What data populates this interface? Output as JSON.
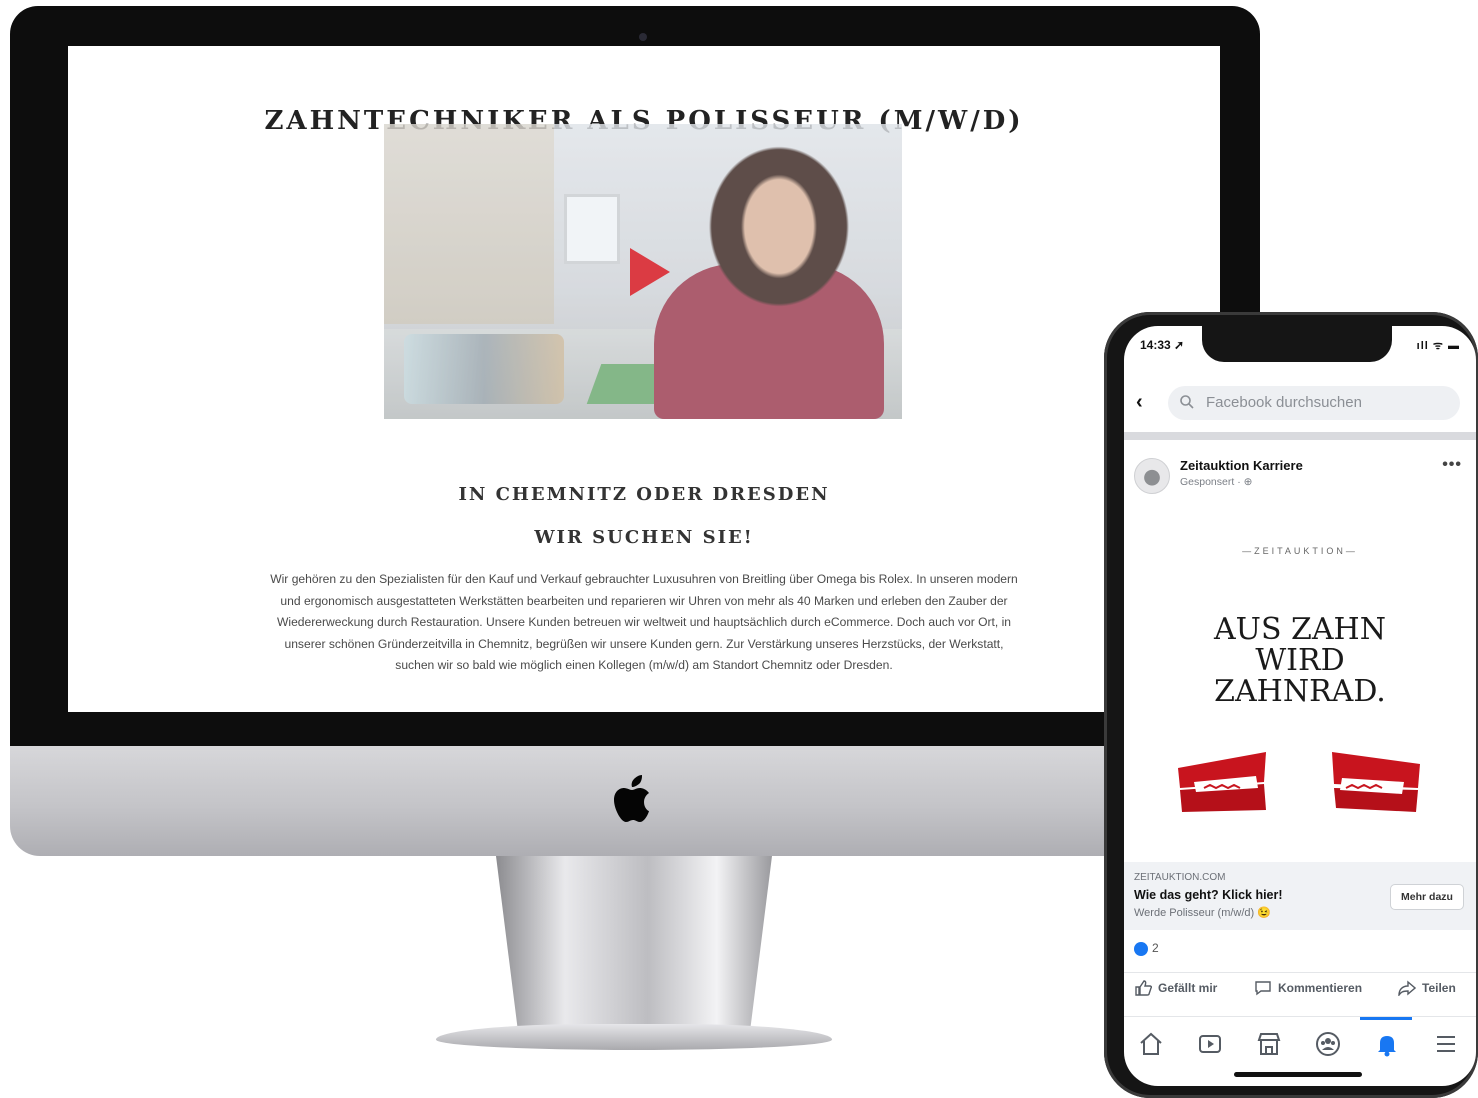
{
  "website": {
    "title": "ZAHNTECHNIKER ALS POLISSEUR (M/W/D)",
    "subheading_1": "IN CHEMNITZ ODER DRESDEN",
    "subheading_2": "WIR SUCHEN SIE!",
    "body": "Wir gehören zu den Spezialisten für den Kauf und Verkauf gebrauchter Luxusuhren von Breitling über Omega bis Rolex. In unseren modern und ergonomisch ausgestatteten Werkstätten bearbeiten und reparieren wir Uhren von mehr als 40 Marken und erleben den Zauber der Wiedererweckung durch Restauration. Unsere Kunden betreuen wir weltweit und hauptsächlich durch eCommerce. Doch auch vor Ort, in unserer schönen Gründerzeitvilla in Chemnitz, begrüßen wir unsere Kunden gern. Zur Verstärkung unseres Herzstücks, der Werkstatt, suchen wir so bald wie möglich einen Kollegen (m/w/d) am Standort Chemnitz oder Dresden.",
    "video_play_icon": "play-icon",
    "accent_color": "#d4111b"
  },
  "phone": {
    "status_time": "14:33 ➚",
    "status_icons": "ıll ᯤ ▬",
    "search_placeholder": "Facebook durchsuchen",
    "post": {
      "page_name": "Zeitauktion Karriere",
      "meta": "Gesponsert · ⊕",
      "brand_mark": "—ZEITAUKTION—",
      "headline_lines": [
        "AUS ZAHN",
        "WIRD",
        "ZAHNRAD."
      ],
      "link_domain": "ZEITAUKTION.COM",
      "link_title": "Wie das geht? Klick hier!",
      "link_desc": "Werde Polisseur (m/w/d) 😉",
      "cta": "Mehr dazu",
      "reaction_count": "2"
    },
    "actions": {
      "like": "Gefällt mir",
      "comment": "Kommentieren",
      "share": "Teilen"
    },
    "tabs": [
      "home-icon",
      "video-icon",
      "marketplace-icon",
      "groups-icon",
      "notifications-icon",
      "menu-icon"
    ],
    "active_tab": "notifications-icon",
    "fb_blue": "#1877f2"
  }
}
